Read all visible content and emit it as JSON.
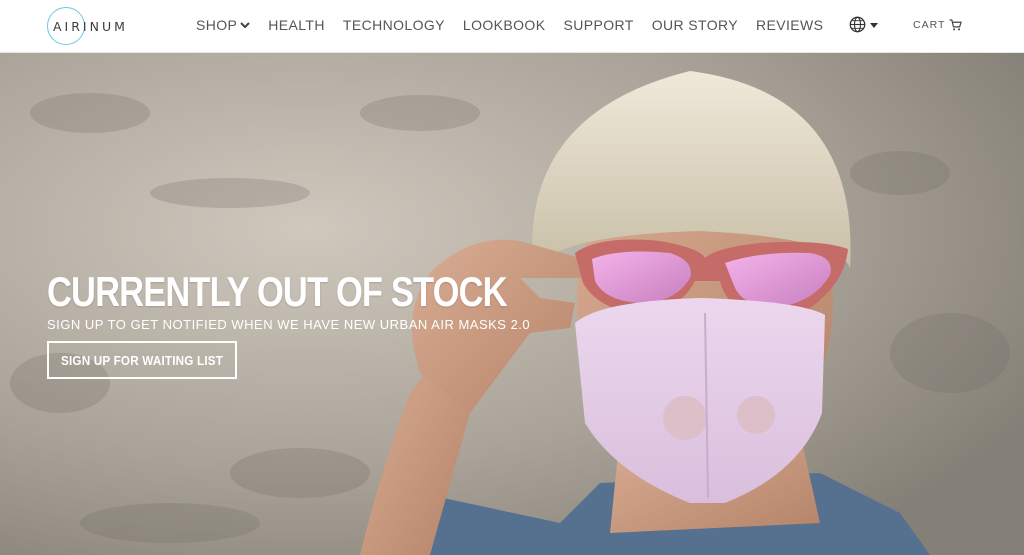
{
  "brand": {
    "logo_text": "AIRINUM",
    "accent_color": "#6bc8e6"
  },
  "nav": {
    "items": [
      {
        "label": "SHOP",
        "has_dropdown": true
      },
      {
        "label": "HEALTH"
      },
      {
        "label": "TECHNOLOGY"
      },
      {
        "label": "LOOKBOOK"
      },
      {
        "label": "SUPPORT"
      },
      {
        "label": "OUR STORY"
      },
      {
        "label": "REVIEWS"
      }
    ],
    "language_icon": "globe-icon",
    "cart_label": "CART",
    "cart_icon": "cart-icon"
  },
  "hero": {
    "title": "CURRENTLY OUT OF STOCK",
    "subtitle": "SIGN UP TO GET NOTIFIED WHEN WE HAVE NEW URBAN AIR MASKS 2.0",
    "button_label": "SIGN UP FOR WAITING LIST"
  }
}
